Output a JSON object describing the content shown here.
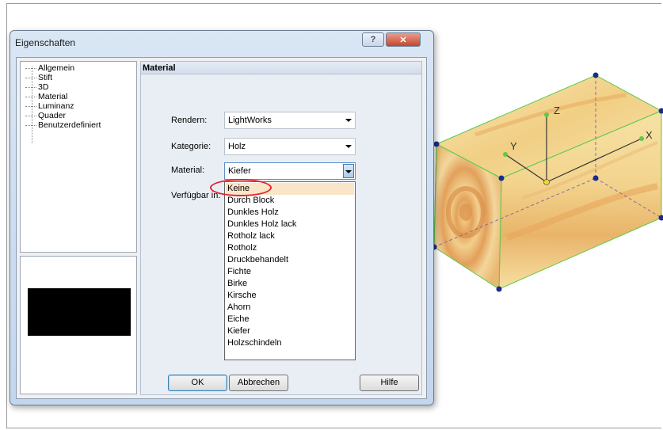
{
  "window": {
    "title": "Eigenschaften",
    "help_glyph": "?",
    "close_glyph": "✕"
  },
  "tree": {
    "items": [
      "Allgemein",
      "Stift",
      "3D",
      "Material",
      "Luminanz",
      "Quader",
      "Benutzerdefiniert"
    ]
  },
  "panel": {
    "title": "Material"
  },
  "form": {
    "render_label": "Rendern:",
    "render_value": "LightWorks",
    "category_label": "Kategorie:",
    "category_value": "Holz",
    "material_label": "Material:",
    "material_value": "Kiefer",
    "available_label": "Verfügbar in:"
  },
  "dropdown": {
    "options": [
      "Keine",
      "Durch Block",
      "Dunkles Holz",
      "Dunkles Holz lack",
      "Rotholz lack",
      "Rotholz",
      "Druckbehandelt",
      "Fichte",
      "Birke",
      "Kirsche",
      "Ahorn",
      "Eiche",
      "Kiefer",
      "Holzschindeln"
    ],
    "highlighted": "Keine"
  },
  "buttons": {
    "ok": "OK",
    "cancel": "Abbrechen",
    "help": "Hilfe"
  },
  "axes": {
    "x": "X",
    "y": "Y",
    "z": "Z"
  },
  "colors": {
    "annotation": "#e0242b",
    "wood_light": "#f6e2a4",
    "wood_dark": "#e3a75a",
    "edge": "#5ec94a",
    "handle": "#1b2b8c"
  },
  "icons": [
    "help-icon",
    "close-icon",
    "dropdown-arrow-icon"
  ]
}
